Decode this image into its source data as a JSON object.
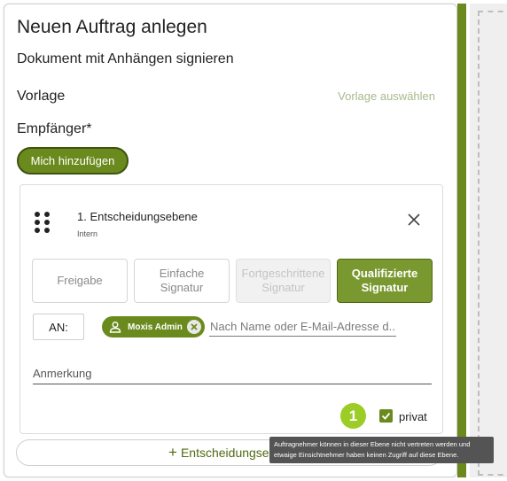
{
  "form": {
    "title": "Neuen Auftrag anlegen",
    "subtitle": "Dokument mit Anhängen signieren",
    "vorlage_label": "Vorlage",
    "vorlage_link": "Vorlage auswählen",
    "empfaenger_label": "Empfänger*",
    "add_me_label": "Mich hinzufügen"
  },
  "level": {
    "title": "1. Entscheidungsebene",
    "subtitle": "Intern",
    "signature_options": [
      {
        "label": "Freigabe",
        "state": "default"
      },
      {
        "label": "Einfache Signatur",
        "state": "default"
      },
      {
        "label": "Fortgeschrittene Signatur",
        "state": "disabled"
      },
      {
        "label": "Qualifizierte Signatur",
        "state": "selected"
      }
    ],
    "an_label": "AN:",
    "recipient_chip": "Moxis Admin",
    "recipient_placeholder": "Nach Name oder E-Mail-Adresse d...",
    "anmerkung_placeholder": "Anmerkung",
    "marker_number": "1",
    "private_label": "privat",
    "private_checked": true
  },
  "add_level_label": "Entscheidungseben",
  "tooltip_text": "Auftragnehmer können in dieser Ebene nicht vertreten werden und etwaige Einsichtnehmer haben keinen Zugriff auf diese Ebene.",
  "icons": [
    "drag-handle-icon",
    "close-icon",
    "user-icon",
    "remove-chip-icon",
    "check-icon",
    "plus-icon"
  ],
  "colors": {
    "accent": "#6b8a1d",
    "selected": "#7a9830",
    "marker": "#9ccd27",
    "link": "#a7b98a"
  }
}
